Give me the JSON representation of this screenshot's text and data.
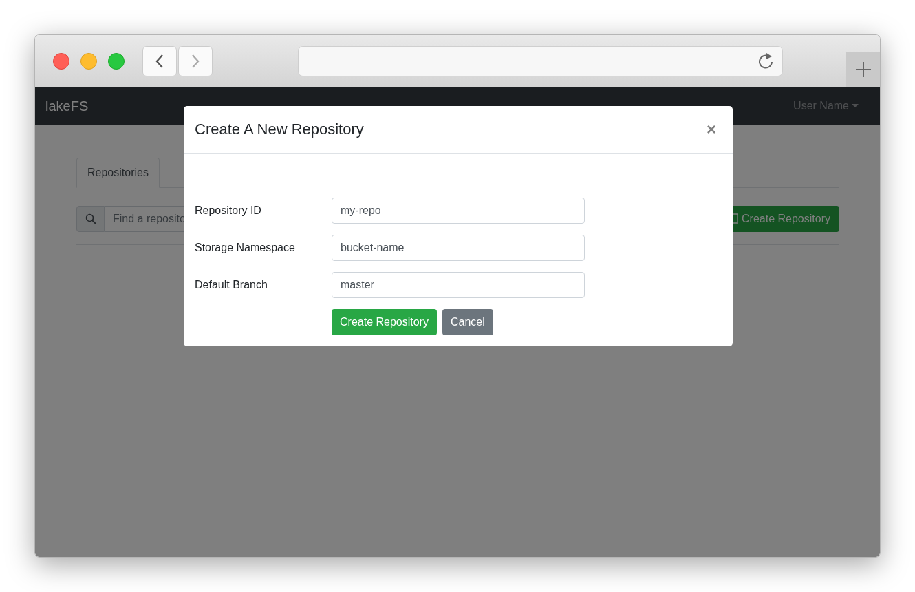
{
  "browser": {
    "nav_buttons": [
      {
        "kind": "back",
        "disabled": false
      },
      {
        "kind": "forward",
        "disabled": true
      }
    ]
  },
  "navbar": {
    "brand": "lakeFS",
    "user_menu": "User Name"
  },
  "tabs": [
    {
      "label": "Repositories",
      "selected": true
    }
  ],
  "search": {
    "placeholder": "Find a reposito"
  },
  "create_button": {
    "label": "Create Repository"
  },
  "modal": {
    "title": "Create A New Repository",
    "close": "×",
    "fields": [
      {
        "label": "Repository ID",
        "value": "my-repo"
      },
      {
        "label": "Storage Namespace",
        "value": "bucket-name"
      },
      {
        "label": "Default Branch",
        "value": "master"
      }
    ],
    "buttons": [
      {
        "kind": "primary",
        "label": "Create Repository"
      },
      {
        "kind": "secondary",
        "label": "Cancel"
      }
    ]
  }
}
